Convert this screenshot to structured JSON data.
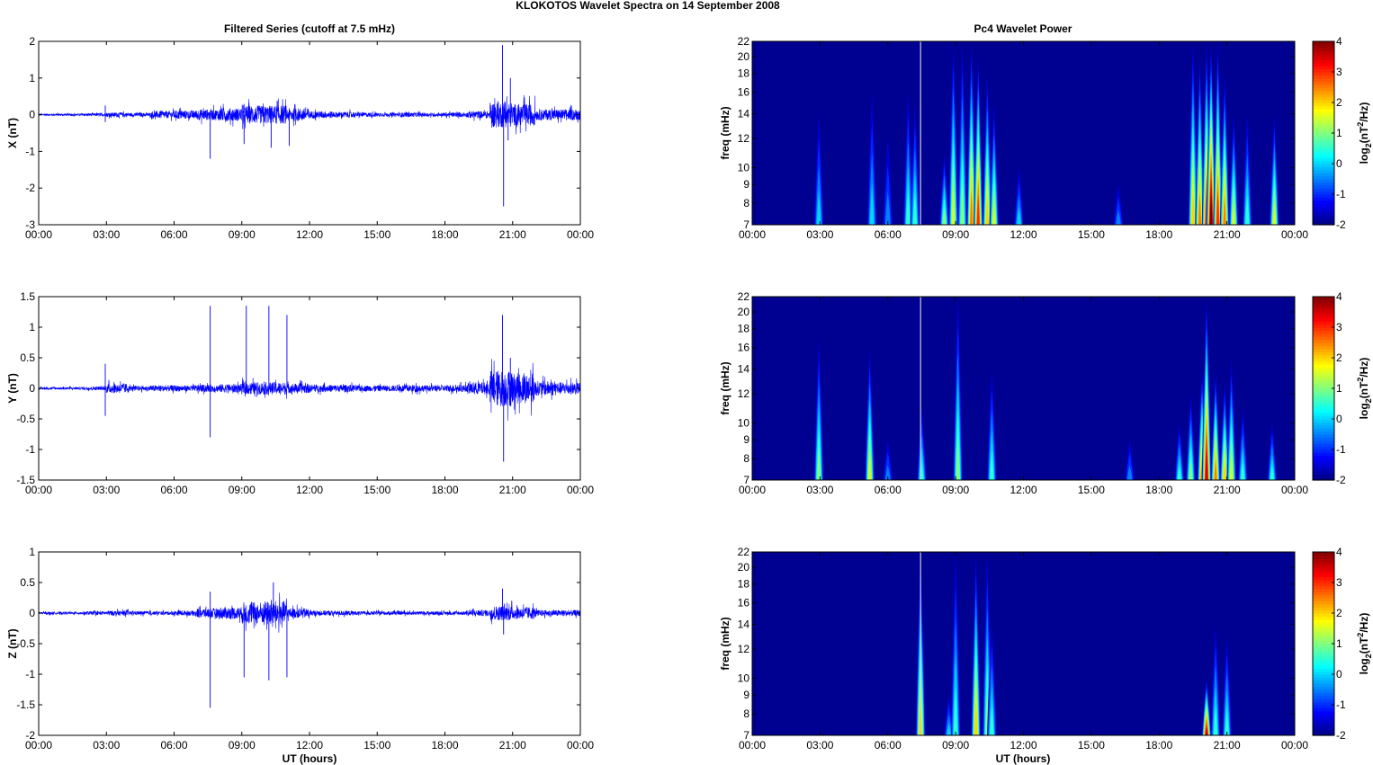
{
  "title": "KLOKOTOS Wavelet Spectra on 14 September 2008",
  "left_title": "Filtered Series (cutoff at 7.5 mHz)",
  "right_title": "Pc4 Wavelet Power",
  "xlabel": "UT (hours)",
  "chart_data": [
    {
      "type": "line",
      "component": "X",
      "ylabel": "X (nT)",
      "xlim": [
        0,
        24
      ],
      "ylim": [
        -3,
        2
      ],
      "yticks": [
        -3,
        -2,
        -1,
        0,
        1,
        2
      ],
      "xtick_labels": [
        "00:00",
        "03:00",
        "06:00",
        "09:00",
        "12:00",
        "15:00",
        "18:00",
        "21:00",
        "00:00"
      ],
      "color": "#0000ff",
      "hourly_envelope_nT": [
        0.03,
        0.03,
        0.04,
        0.06,
        0.05,
        0.1,
        0.12,
        0.15,
        0.18,
        0.25,
        0.25,
        0.18,
        0.1,
        0.08,
        0.06,
        0.05,
        0.06,
        0.05,
        0.06,
        0.1,
        0.35,
        0.3,
        0.15,
        0.15
      ],
      "spikes": [
        [
          2.95,
          0.25
        ],
        [
          2.95,
          -0.2
        ],
        [
          7.6,
          -1.2
        ],
        [
          9.1,
          -0.8
        ],
        [
          10.3,
          -0.9
        ],
        [
          11.1,
          -0.85
        ],
        [
          20.55,
          1.9
        ],
        [
          20.6,
          -2.5
        ],
        [
          20.9,
          1.0
        ],
        [
          20.8,
          -0.7
        ]
      ]
    },
    {
      "type": "line",
      "component": "Y",
      "ylabel": "Y (nT)",
      "xlim": [
        0,
        24
      ],
      "ylim": [
        -1.5,
        1.5
      ],
      "yticks": [
        -1.5,
        -1,
        -0.5,
        0,
        0.5,
        1,
        1.5
      ],
      "xtick_labels": [
        "00:00",
        "03:00",
        "06:00",
        "09:00",
        "12:00",
        "15:00",
        "18:00",
        "21:00",
        "00:00"
      ],
      "color": "#0000ff",
      "hourly_envelope_nT": [
        0.02,
        0.02,
        0.03,
        0.08,
        0.04,
        0.05,
        0.05,
        0.06,
        0.07,
        0.1,
        0.1,
        0.08,
        0.06,
        0.06,
        0.05,
        0.05,
        0.06,
        0.05,
        0.06,
        0.1,
        0.3,
        0.25,
        0.12,
        0.1
      ],
      "spikes": [
        [
          2.95,
          0.4
        ],
        [
          2.95,
          -0.45
        ],
        [
          7.6,
          1.35
        ],
        [
          7.6,
          -0.8
        ],
        [
          9.2,
          1.35
        ],
        [
          10.2,
          1.35
        ],
        [
          11.0,
          1.2
        ],
        [
          20.55,
          1.2
        ],
        [
          20.6,
          -1.2
        ],
        [
          20.9,
          0.5
        ]
      ]
    },
    {
      "type": "line",
      "component": "Z",
      "ylabel": "Z (nT)",
      "xlim": [
        0,
        24
      ],
      "ylim": [
        -2,
        1
      ],
      "yticks": [
        -2,
        -1.5,
        -1,
        -0.5,
        0,
        0.5,
        1
      ],
      "xtick_labels": [
        "00:00",
        "03:00",
        "06:00",
        "09:00",
        "12:00",
        "15:00",
        "18:00",
        "21:00",
        "00:00"
      ],
      "color": "#0000ff",
      "hourly_envelope_nT": [
        0.02,
        0.02,
        0.03,
        0.04,
        0.03,
        0.03,
        0.04,
        0.08,
        0.1,
        0.18,
        0.2,
        0.08,
        0.04,
        0.04,
        0.03,
        0.03,
        0.03,
        0.03,
        0.03,
        0.05,
        0.12,
        0.1,
        0.05,
        0.05
      ],
      "spikes": [
        [
          7.6,
          0.35
        ],
        [
          7.6,
          -1.55
        ],
        [
          9.1,
          -1.05
        ],
        [
          10.2,
          -1.1
        ],
        [
          10.4,
          0.5
        ],
        [
          11.0,
          -1.05
        ],
        [
          20.55,
          0.4
        ],
        [
          20.6,
          -0.35
        ]
      ]
    },
    {
      "type": "heatmap",
      "component": "X",
      "ylabel": "freq (mHz)",
      "xlim": [
        0,
        24
      ],
      "ylim": [
        7,
        22
      ],
      "yscale": "log",
      "yticks": [
        7,
        8,
        9,
        10,
        12,
        14,
        16,
        18,
        20,
        22
      ],
      "xtick_labels": [
        "00:00",
        "03:00",
        "06:00",
        "09:00",
        "12:00",
        "15:00",
        "18:00",
        "21:00",
        "00:00"
      ],
      "clim": [
        -2,
        4
      ],
      "cbar_ticks": [
        -2,
        -1,
        0,
        1,
        2,
        3,
        4
      ],
      "cbar_label": "log2(nT^2/Hz)",
      "gap_line_hour": 7.45,
      "bursts_hour_fmax_power": [
        [
          2.95,
          14,
          0
        ],
        [
          5.3,
          16,
          0
        ],
        [
          6.0,
          12,
          -0.5
        ],
        [
          6.9,
          16,
          0.5
        ],
        [
          7.2,
          15,
          0.5
        ],
        [
          8.5,
          11,
          1
        ],
        [
          8.9,
          22,
          1.5
        ],
        [
          9.3,
          22,
          1
        ],
        [
          9.7,
          22,
          2.5
        ],
        [
          10.0,
          20,
          3
        ],
        [
          10.4,
          18,
          2
        ],
        [
          10.7,
          15,
          1.5
        ],
        [
          11.8,
          10,
          0
        ],
        [
          16.2,
          9,
          -0.5
        ],
        [
          19.5,
          22,
          2
        ],
        [
          19.8,
          20,
          2.5
        ],
        [
          20.1,
          22,
          3
        ],
        [
          20.3,
          22,
          4
        ],
        [
          20.6,
          22,
          3
        ],
        [
          20.9,
          18,
          2.5
        ],
        [
          21.3,
          14,
          1.5
        ],
        [
          21.9,
          14,
          0.5
        ],
        [
          23.1,
          14,
          1.5
        ]
      ]
    },
    {
      "type": "heatmap",
      "component": "Y",
      "ylabel": "freq (mHz)",
      "xlim": [
        0,
        24
      ],
      "ylim": [
        7,
        22
      ],
      "yscale": "log",
      "yticks": [
        7,
        8,
        9,
        10,
        12,
        14,
        16,
        18,
        20,
        22
      ],
      "xtick_labels": [
        "00:00",
        "03:00",
        "06:00",
        "09:00",
        "12:00",
        "15:00",
        "18:00",
        "21:00",
        "00:00"
      ],
      "clim": [
        -2,
        4
      ],
      "cbar_ticks": [
        -2,
        -1,
        0,
        1,
        2,
        3,
        4
      ],
      "cbar_label": "log2(nT^2/Hz)",
      "gap_line_hour": 7.45,
      "bursts_hour_fmax_power": [
        [
          2.95,
          17,
          1
        ],
        [
          5.2,
          16,
          1.5
        ],
        [
          6.0,
          9,
          -0.5
        ],
        [
          7.5,
          11,
          0.5
        ],
        [
          9.1,
          22,
          1
        ],
        [
          10.6,
          14,
          0.5
        ],
        [
          16.7,
          9,
          -0.5
        ],
        [
          18.9,
          10,
          0.5
        ],
        [
          19.4,
          12,
          1
        ],
        [
          19.9,
          14,
          2.5
        ],
        [
          20.1,
          22,
          3.5
        ],
        [
          20.5,
          14,
          2.5
        ],
        [
          20.9,
          13,
          2
        ],
        [
          21.2,
          15,
          1.5
        ],
        [
          21.7,
          11,
          0.5
        ],
        [
          23.0,
          10,
          0.5
        ]
      ]
    },
    {
      "type": "heatmap",
      "component": "Z",
      "ylabel": "freq (mHz)",
      "xlim": [
        0,
        24
      ],
      "ylim": [
        7,
        22
      ],
      "yscale": "log",
      "yticks": [
        7,
        8,
        9,
        10,
        12,
        14,
        16,
        18,
        20,
        22
      ],
      "xtick_labels": [
        "00:00",
        "03:00",
        "06:00",
        "09:00",
        "12:00",
        "15:00",
        "18:00",
        "21:00",
        "00:00"
      ],
      "clim": [
        -2,
        4
      ],
      "cbar_ticks": [
        -2,
        -1,
        0,
        1,
        2,
        3,
        4
      ],
      "cbar_label": "log2(nT^2/Hz)",
      "gap_line_hour": 7.45,
      "bursts_hour_fmax_power": [
        [
          7.45,
          22,
          2
        ],
        [
          8.7,
          9,
          0
        ],
        [
          9.0,
          22,
          0.5
        ],
        [
          9.9,
          22,
          2
        ],
        [
          10.4,
          22,
          1
        ],
        [
          10.6,
          14,
          0.5
        ],
        [
          20.1,
          10,
          3.5
        ],
        [
          20.5,
          14,
          0.5
        ],
        [
          21.0,
          13,
          0.5
        ]
      ]
    }
  ]
}
